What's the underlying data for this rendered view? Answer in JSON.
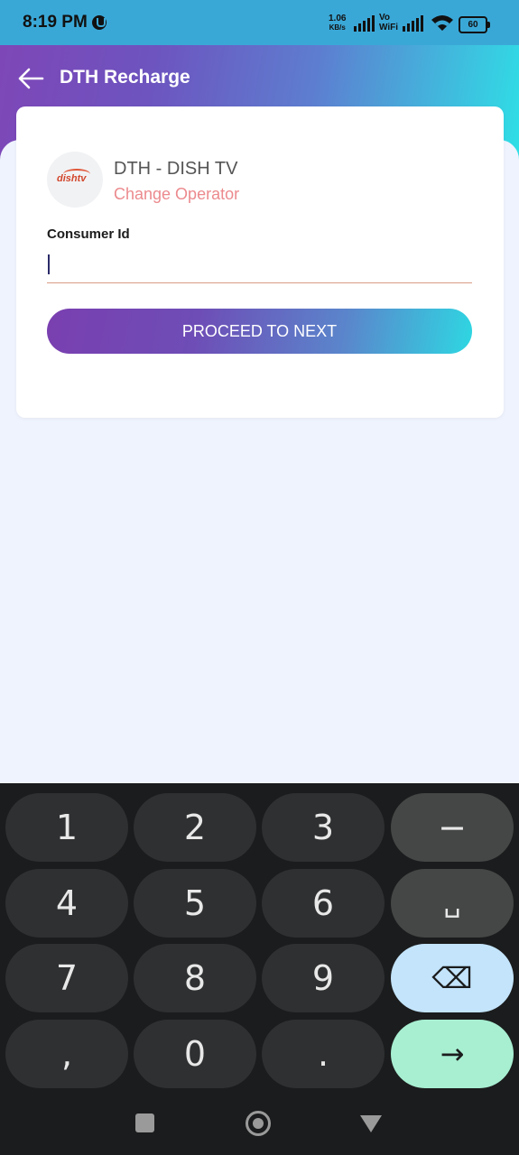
{
  "status_bar": {
    "time": "8:19 PM",
    "net_speed_value": "1.06",
    "net_speed_unit": "KB/s",
    "vowifi_top": "Vo",
    "vowifi_bottom": "WiFi",
    "battery": "60"
  },
  "header": {
    "title": "DTH Recharge"
  },
  "operator": {
    "logo_text": "dishtv",
    "name": "DTH - DISH TV",
    "change_label": "Change Operator"
  },
  "form": {
    "consumer_label": "Consumer Id",
    "consumer_value": "",
    "proceed_label": "PROCEED TO NEXT"
  },
  "keyboard": {
    "rows": [
      [
        "1",
        "2",
        "3",
        "−"
      ],
      [
        "4",
        "5",
        "6",
        "␣"
      ],
      [
        "7",
        "8",
        "9",
        "⌫"
      ],
      [
        ",",
        "0",
        ".",
        "→"
      ]
    ]
  },
  "colors": {
    "accent_purple": "#7a3fb0",
    "accent_cyan": "#2ed7e2",
    "change_operator": "#ec8a8e"
  }
}
